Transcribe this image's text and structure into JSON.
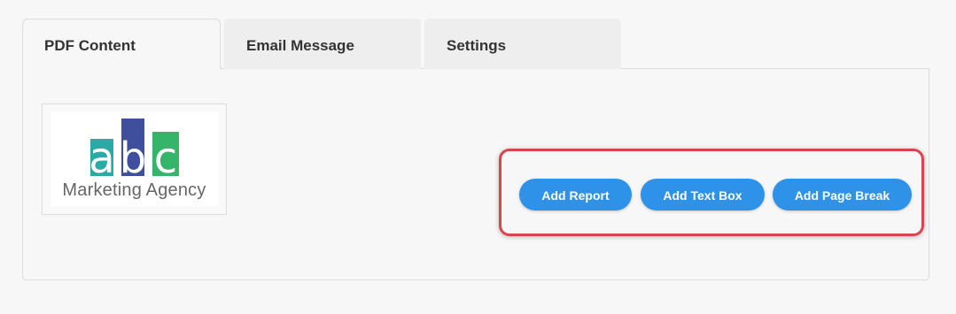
{
  "tabs": [
    {
      "label": "PDF Content",
      "active": true
    },
    {
      "label": "Email Message",
      "active": false
    },
    {
      "label": "Settings",
      "active": false
    }
  ],
  "logo": {
    "letters": [
      "a",
      "b",
      "c"
    ],
    "subtitle": "Marketing Agency",
    "colors": {
      "a": "#2aa9a6",
      "b": "#3f4f9d",
      "c": "#35b56a"
    }
  },
  "actions": {
    "add_report": "Add Report",
    "add_text_box": "Add Text Box",
    "add_page_break": "Add Page Break"
  },
  "colors": {
    "button": "#2f92e9",
    "highlight": "#d9444f"
  }
}
